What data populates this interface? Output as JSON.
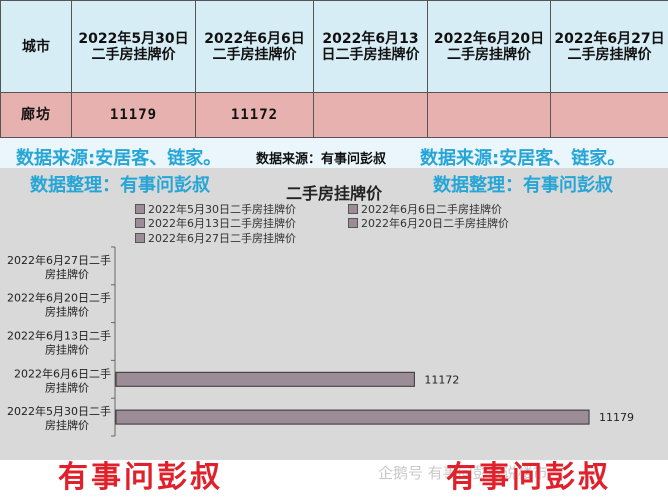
{
  "table": {
    "headers": [
      "城市",
      "2022年5月30日二手房挂牌价",
      "2022年6月6日二手房挂牌价",
      "2022年6月13日二手房挂牌价",
      "2022年6月20日二手房挂牌价",
      "2022年6月27日二手房挂牌价"
    ],
    "row": [
      "廊坊",
      "11179",
      "11172",
      "",
      "",
      ""
    ]
  },
  "banner": {
    "source_big": "数据来源:安居客、链家。",
    "source_small": "数据来源：有事问彭叔",
    "organizer": "数据整理：有事问彭叔"
  },
  "signature": "有事问彭叔",
  "watermark": "企鹅号 有事问彭叔说楼市",
  "chart_data": {
    "type": "bar",
    "orientation": "horizontal",
    "title": "二手房挂牌价",
    "categories": [
      "2022年5月30日二手房挂牌价",
      "2022年6月6日二手房挂牌价",
      "2022年6月13日二手房挂牌价",
      "2022年6月20日二手房挂牌价",
      "2022年6月27日二手房挂牌价"
    ],
    "values": [
      11179,
      11172,
      null,
      null,
      null
    ],
    "data_labels": [
      "11179",
      "11172",
      "",
      "",
      ""
    ],
    "legend": [
      "2022年5月30日二手房挂牌价",
      "2022年6月6日二手房挂牌价",
      "2022年6月13日二手房挂牌价",
      "2022年6月20日二手房挂牌价",
      "2022年6月27日二手房挂牌价"
    ],
    "legend_position": "top",
    "xlim": [
      11160,
      11180
    ],
    "grid": false,
    "colors": {
      "bar": "#9c8c98",
      "bar_border": "#333333",
      "background": "#d9d9d9"
    }
  }
}
